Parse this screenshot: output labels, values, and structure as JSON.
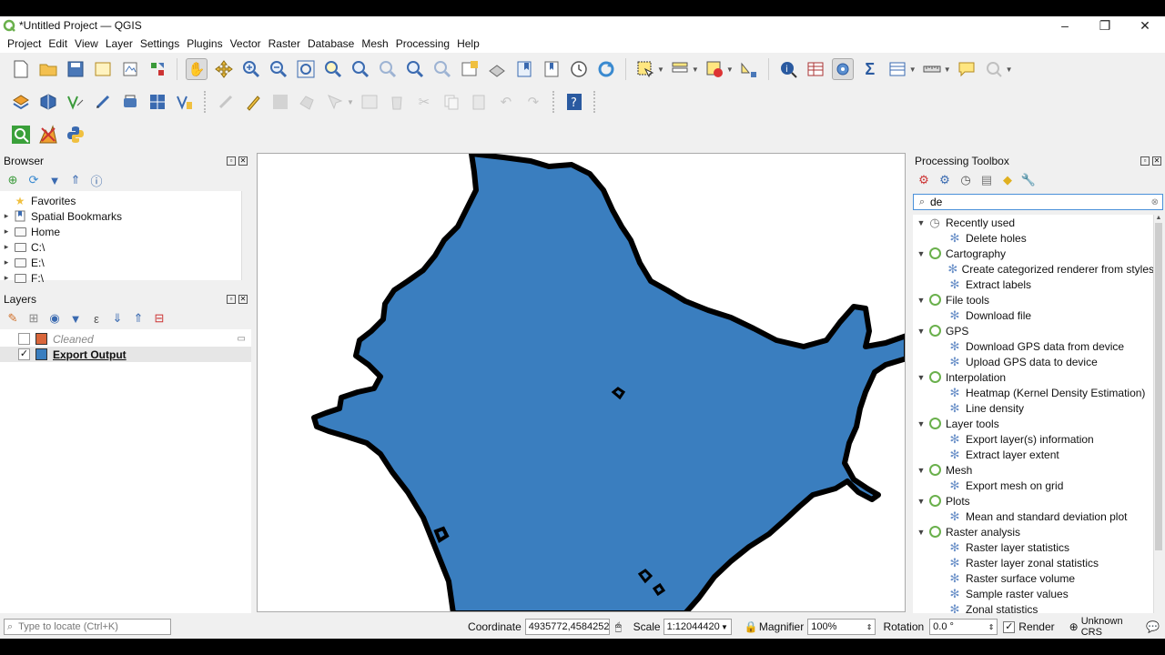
{
  "window": {
    "title": "*Untitled Project — QGIS"
  },
  "menu": [
    "Project",
    "Edit",
    "View",
    "Layer",
    "Settings",
    "Plugins",
    "Vector",
    "Raster",
    "Database",
    "Mesh",
    "Processing",
    "Help"
  ],
  "browser": {
    "title": "Browser",
    "items": [
      {
        "label": "Favorites",
        "icon": "star-icon",
        "arrow": ""
      },
      {
        "label": "Spatial Bookmarks",
        "icon": "bookmark-icon",
        "arrow": "▸"
      },
      {
        "label": "Home",
        "icon": "folder-icon",
        "arrow": "▸"
      },
      {
        "label": "C:\\",
        "icon": "folder-icon",
        "arrow": "▸"
      },
      {
        "label": "E:\\",
        "icon": "folder-icon",
        "arrow": "▸"
      },
      {
        "label": "F:\\",
        "icon": "folder-icon",
        "arrow": "▸"
      }
    ]
  },
  "layers": {
    "title": "Layers",
    "items": [
      {
        "label": "Cleaned",
        "checked": false,
        "color": "#d9663b"
      },
      {
        "label": "Export Output",
        "checked": true,
        "color": "#3a7ebf"
      }
    ]
  },
  "toolbox": {
    "title": "Processing Toolbox",
    "search_value": "de",
    "groups": [
      {
        "name": "Recently used",
        "items": [
          "Delete holes"
        ]
      },
      {
        "name": "Cartography",
        "items": [
          "Create categorized renderer from styles",
          "Extract labels"
        ]
      },
      {
        "name": "File tools",
        "items": [
          "Download file"
        ]
      },
      {
        "name": "GPS",
        "items": [
          "Download GPS data from device",
          "Upload GPS data to device"
        ]
      },
      {
        "name": "Interpolation",
        "items": [
          "Heatmap (Kernel Density Estimation)",
          "Line density"
        ]
      },
      {
        "name": "Layer tools",
        "items": [
          "Export layer(s) information",
          "Extract layer extent"
        ]
      },
      {
        "name": "Mesh",
        "items": [
          "Export mesh on grid"
        ]
      },
      {
        "name": "Plots",
        "items": [
          "Mean and standard deviation plot"
        ]
      },
      {
        "name": "Raster analysis",
        "items": [
          "Raster layer statistics",
          "Raster layer zonal statistics",
          "Raster surface volume",
          "Sample raster values",
          "Zonal statistics"
        ]
      }
    ]
  },
  "status": {
    "locate_placeholder": "Type to locate (Ctrl+K)",
    "coordinate_label": "Coordinate",
    "coordinate_value": "4935772,4584252",
    "scale_label": "Scale",
    "scale_value": "1:12044420",
    "magnifier_label": "Magnifier",
    "magnifier_value": "100%",
    "rotation_label": "Rotation",
    "rotation_value": "0.0 °",
    "render_label": "Render",
    "crs_label": "Unknown CRS"
  },
  "colors": {
    "fill": "#3a7ebf",
    "outline": "#000000",
    "accent": "#6ab04c"
  }
}
